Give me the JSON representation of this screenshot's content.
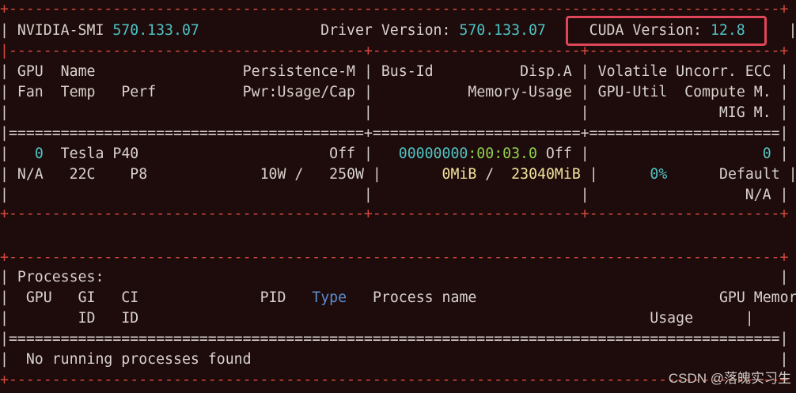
{
  "header": {
    "smi_label": "NVIDIA-SMI",
    "smi_version": "570.133.07",
    "driver_label": "Driver Version:",
    "driver_version": "570.133.07",
    "cuda_label": "CUDA Version:",
    "cuda_version": "12.8"
  },
  "gpu_headers": {
    "row1": {
      "gpu": "GPU",
      "name": "Name",
      "persistence": "Persistence-M",
      "busid": "Bus-Id",
      "disp": "Disp.A",
      "volatile": "Volatile Uncorr. ECC"
    },
    "row2": {
      "fan": "Fan",
      "temp": "Temp",
      "perf": "Perf",
      "pwr": "Pwr:Usage/Cap",
      "memusage": "Memory-Usage",
      "gpuutil": "GPU-Util",
      "compute": "Compute M."
    },
    "row3": {
      "mig": "MIG M."
    }
  },
  "gpu_rows": [
    {
      "index": "0",
      "name": "Tesla P40",
      "persistence": "Off",
      "bus_id_prefix": "00000000",
      "bus_id_suffix": ":00:03.0",
      "disp": "Off",
      "ecc": "0",
      "fan": "N/A",
      "temp": "22C",
      "perf": "P8",
      "power_usage": "10W",
      "power_cap": "250W",
      "mem_used": "0MiB",
      "mem_total": "23040MiB",
      "gpu_util": "0%",
      "compute_mode": "Default",
      "mig_mode": "N/A"
    }
  ],
  "processes": {
    "title": "Processes:",
    "headers": {
      "gpu": "GPU",
      "gi": "GI",
      "ci": "CI",
      "pid": "PID",
      "type": "Type",
      "process_name": "Process name",
      "gpu_memory": "GPU Memory",
      "gi_id": "ID",
      "ci_id": "ID",
      "usage": "Usage"
    },
    "empty_message": "No running processes found"
  },
  "watermark": "CSDN @落魄实习生",
  "colors": {
    "background": "#1e0b0b",
    "dash": "#d24a3f",
    "cyan": "#4fc3c3",
    "green": "#8fd14f",
    "yellow": "#f2e29c",
    "blue": "#5b8fd0",
    "highlight_box": "#e0465a"
  }
}
